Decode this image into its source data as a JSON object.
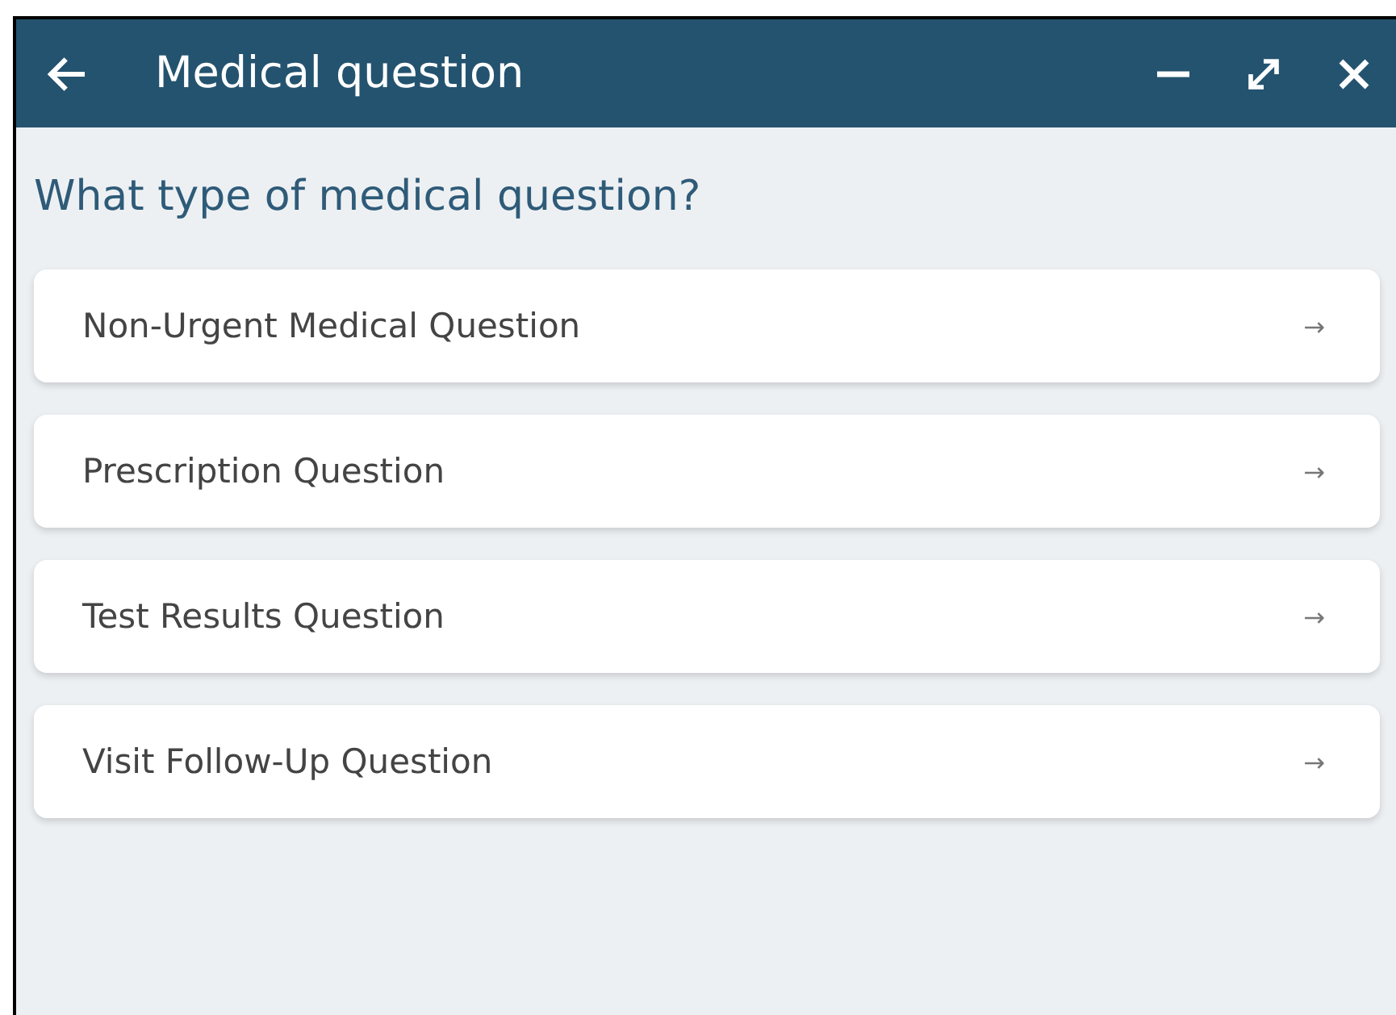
{
  "window": {
    "title": "Medical question"
  },
  "heading": "What type of medical question?",
  "options": [
    {
      "label": "Non-Urgent Medical Question",
      "arrow": "→"
    },
    {
      "label": "Prescription Question",
      "arrow": "→"
    },
    {
      "label": "Test Results Question",
      "arrow": "→"
    },
    {
      "label": "Visit Follow-Up Question",
      "arrow": "→"
    }
  ]
}
